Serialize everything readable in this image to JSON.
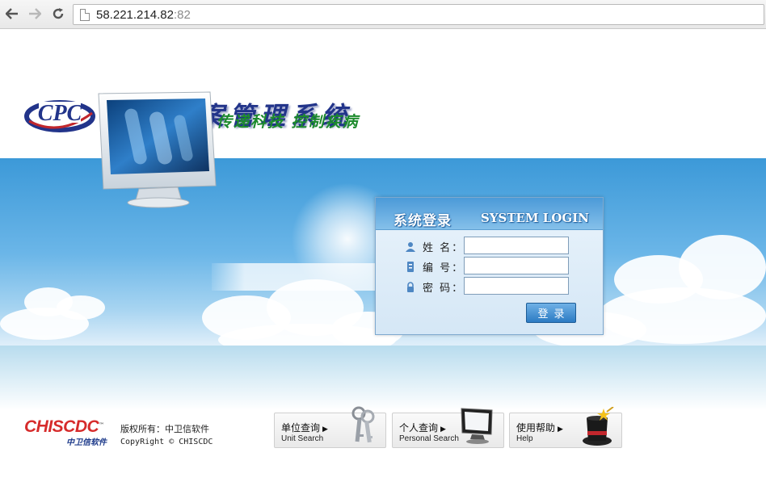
{
  "browser": {
    "back_icon": "back-arrow-icon",
    "forward_icon": "forward-arrow-icon",
    "reload_icon": "reload-icon",
    "url_host": "58.221.214.82",
    "url_port": ":82"
  },
  "header": {
    "system_title": "体检档案管理系统",
    "logo_letters": "CPC"
  },
  "banner": {
    "slogan": "传递科技  控制疾病"
  },
  "login": {
    "title_cn": "系统登录",
    "title_en": "SYSTEM LOGIN",
    "fields": [
      {
        "label": "姓  名：",
        "icon": "user-icon",
        "value": ""
      },
      {
        "label": "编  号：",
        "icon": "id-card-icon",
        "value": ""
      },
      {
        "label": "密  码：",
        "icon": "lock-icon",
        "value": ""
      }
    ],
    "submit_label": "登录"
  },
  "footer": {
    "brand": "CHISCDC",
    "brand_tm": "™",
    "brand_sub": "中卫信软件",
    "copyright_line1": "版权所有：中卫信软件",
    "copyright_line2": "CopyRight © CHISCDC",
    "quick_links": [
      {
        "cn": "单位查询",
        "en": "Unit Search",
        "icon": "keys-icon"
      },
      {
        "cn": "个人查询",
        "en": "Personal Search",
        "icon": "computer-monitor-icon"
      },
      {
        "cn": "使用帮助",
        "en": "Help",
        "icon": "magic-hat-icon"
      }
    ]
  },
  "colors": {
    "title_blue": "#22348a",
    "brand_red": "#d62b2b",
    "slogan_green": "#1c8a2c",
    "login_header_blue": "#4b9ad8"
  }
}
